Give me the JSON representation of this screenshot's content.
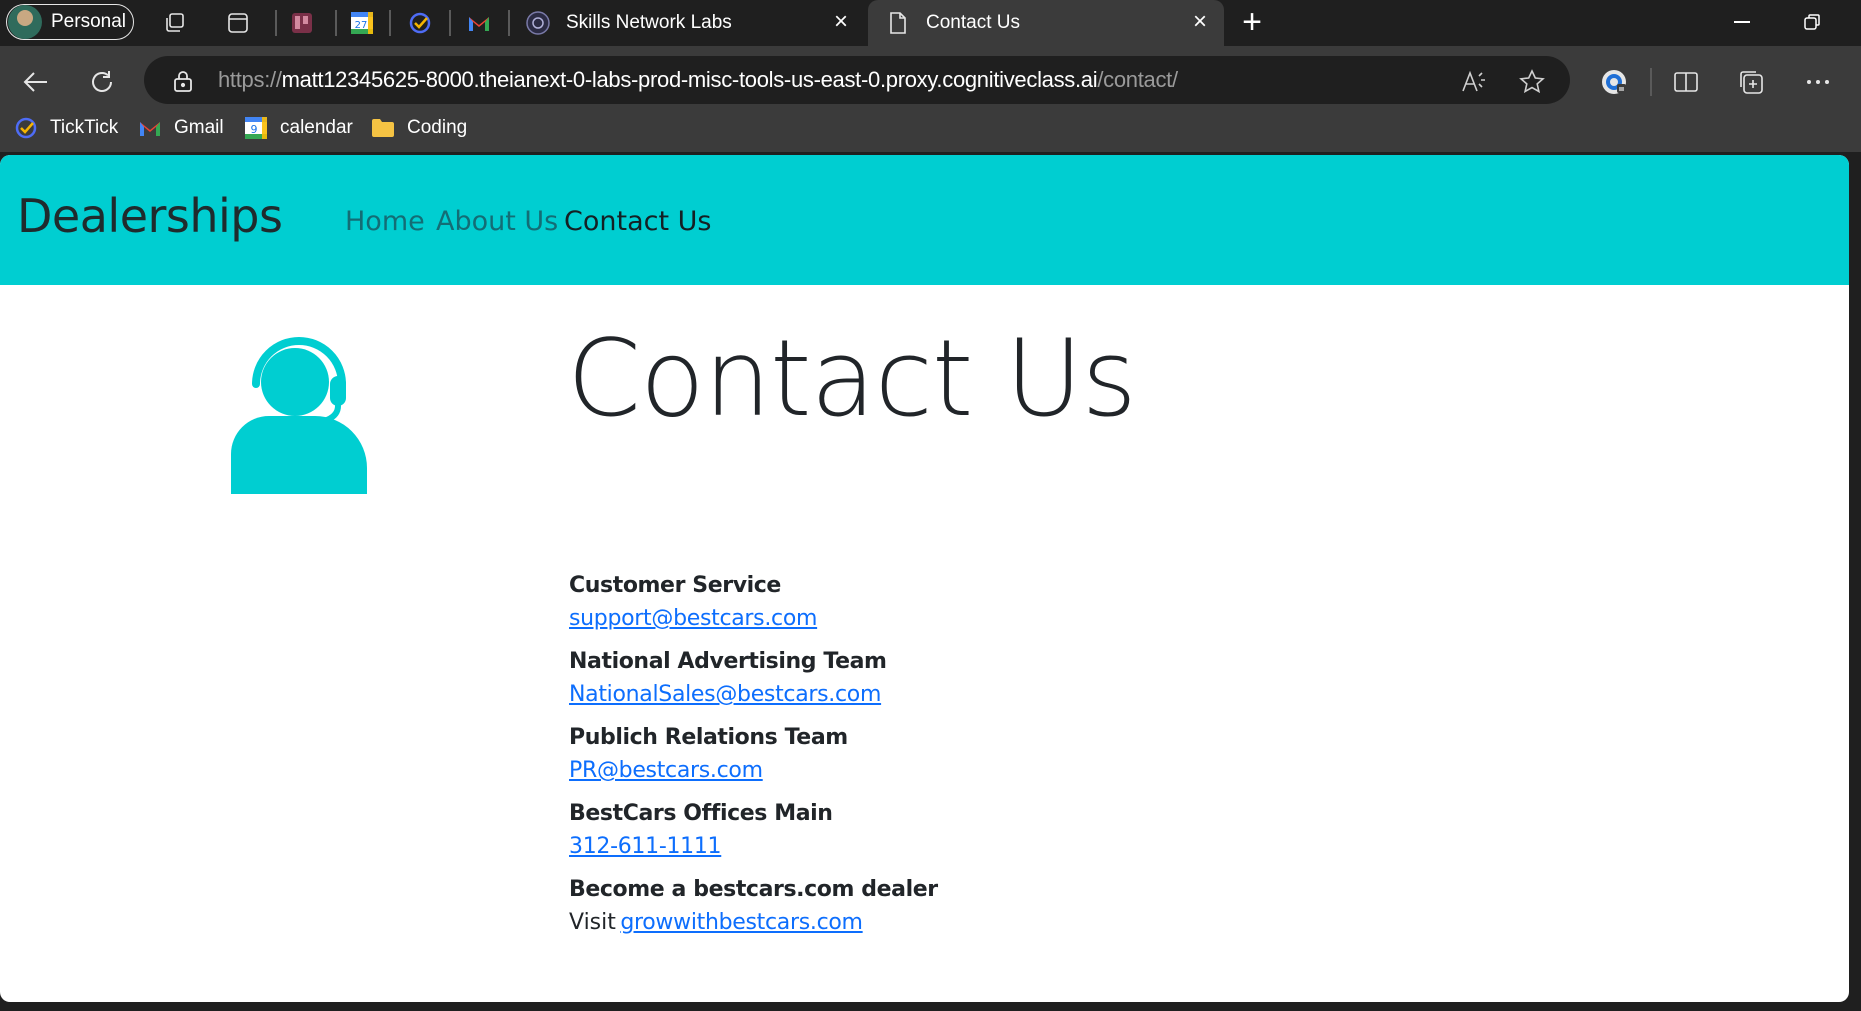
{
  "browser": {
    "profile_label": "Personal",
    "tabs": [
      {
        "title": "Skills Network Labs",
        "active": false
      },
      {
        "title": "Contact Us",
        "active": true
      }
    ],
    "url_prefix": "https://",
    "url_host": "matt12345625-8000.theianext-0-labs-prod-misc-tools-us-east-0.proxy.cognitiveclass.ai",
    "url_path": "/contact/",
    "bookmarks": [
      {
        "label": "TickTick"
      },
      {
        "label": "Gmail"
      },
      {
        "label": "calendar"
      },
      {
        "label": "Coding"
      }
    ],
    "calendar_day": "27",
    "calendar_bookmark_day": "9"
  },
  "site": {
    "brand": "Dealerships",
    "nav": [
      {
        "label": "Home"
      },
      {
        "label": "About Us"
      },
      {
        "label": "Contact Us"
      }
    ],
    "accent": "#00ced1",
    "link_color": "#0d6efd"
  },
  "page": {
    "heading": "Contact Us",
    "contacts": [
      {
        "title": "Customer Service",
        "link": "support@bestcars.com"
      },
      {
        "title": "National Advertising Team",
        "link": "NationalSales@bestcars.com"
      },
      {
        "title": "Publich Relations Team",
        "link": "PR@bestcars.com"
      },
      {
        "title": "BestCars Offices Main",
        "link": "312-611-1111"
      },
      {
        "title": "Become a bestcars.com dealer",
        "prefix": "Visit",
        "link": "growwithbestcars.com"
      }
    ]
  }
}
